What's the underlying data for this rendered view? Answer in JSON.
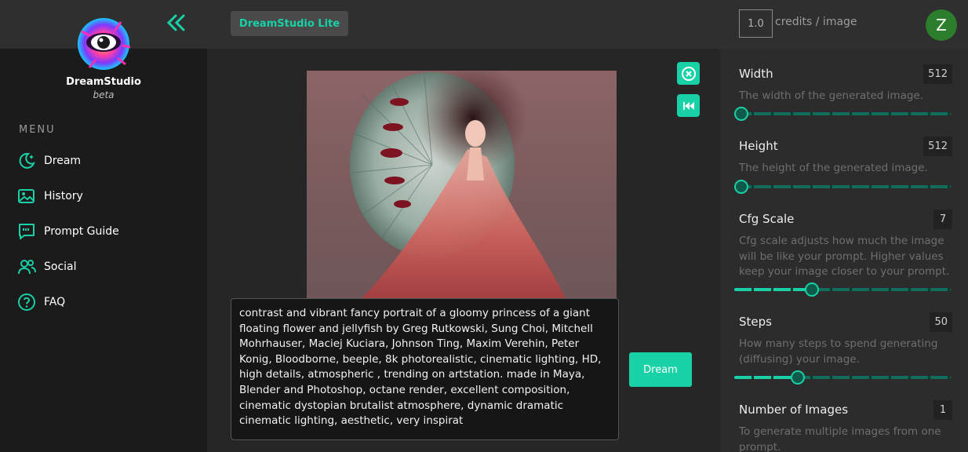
{
  "app": {
    "brand_name": "DreamStudio",
    "brand_sub": "beta",
    "title_pill": "DreamStudio Lite"
  },
  "header": {
    "credits_value": "1.0",
    "credits_label": "credits / image",
    "avatar_initial": "Z"
  },
  "sidebar": {
    "menu_title": "MENU",
    "items": [
      {
        "label": "Dream",
        "icon": "moon-stars-icon"
      },
      {
        "label": "History",
        "icon": "gallery-icon"
      },
      {
        "label": "Prompt Guide",
        "icon": "quote-bubble-icon"
      },
      {
        "label": "Social",
        "icon": "users-icon"
      },
      {
        "label": "FAQ",
        "icon": "question-circle-icon"
      }
    ]
  },
  "main": {
    "prompt_text": "contrast and vibrant fancy portrait of a gloomy princess of a giant floating flower and jellyfish by Greg Rutkowski, Sung Choi, Mitchell Mohrhauser, Maciej Kuciara, Johnson Ting, Maxim Verehin, Peter Konig, Bloodborne, beeple, 8k photorealistic, cinematic lighting, HD, high details, atmospheric , trending on artstation. made in Maya, Blender and Photoshop, octane render, excellent composition, cinematic dystopian brutalist atmosphere, dynamic dramatic cinematic lighting, aesthetic, very inspirat",
    "dream_button": "Dream"
  },
  "settings": {
    "width": {
      "label": "Width",
      "value": "512",
      "description": "The width of the generated image.",
      "fraction": 0.0
    },
    "height": {
      "label": "Height",
      "value": "512",
      "description": "The height of the generated image.",
      "fraction": 0.0
    },
    "cfg": {
      "label": "Cfg Scale",
      "value": "7",
      "description": "Cfg scale adjusts how much the image will be like your prompt. Higher values keep your image closer to your prompt.",
      "fraction": 0.35
    },
    "steps": {
      "label": "Steps",
      "value": "50",
      "description": "How many steps to spend generating (diffusing) your image.",
      "fraction": 0.28
    },
    "num_images": {
      "label": "Number of Images",
      "value": "1",
      "description": "To generate multiple images from one prompt."
    }
  },
  "colors": {
    "accent": "#18d1a6",
    "avatar_bg": "#2c7d2c"
  }
}
